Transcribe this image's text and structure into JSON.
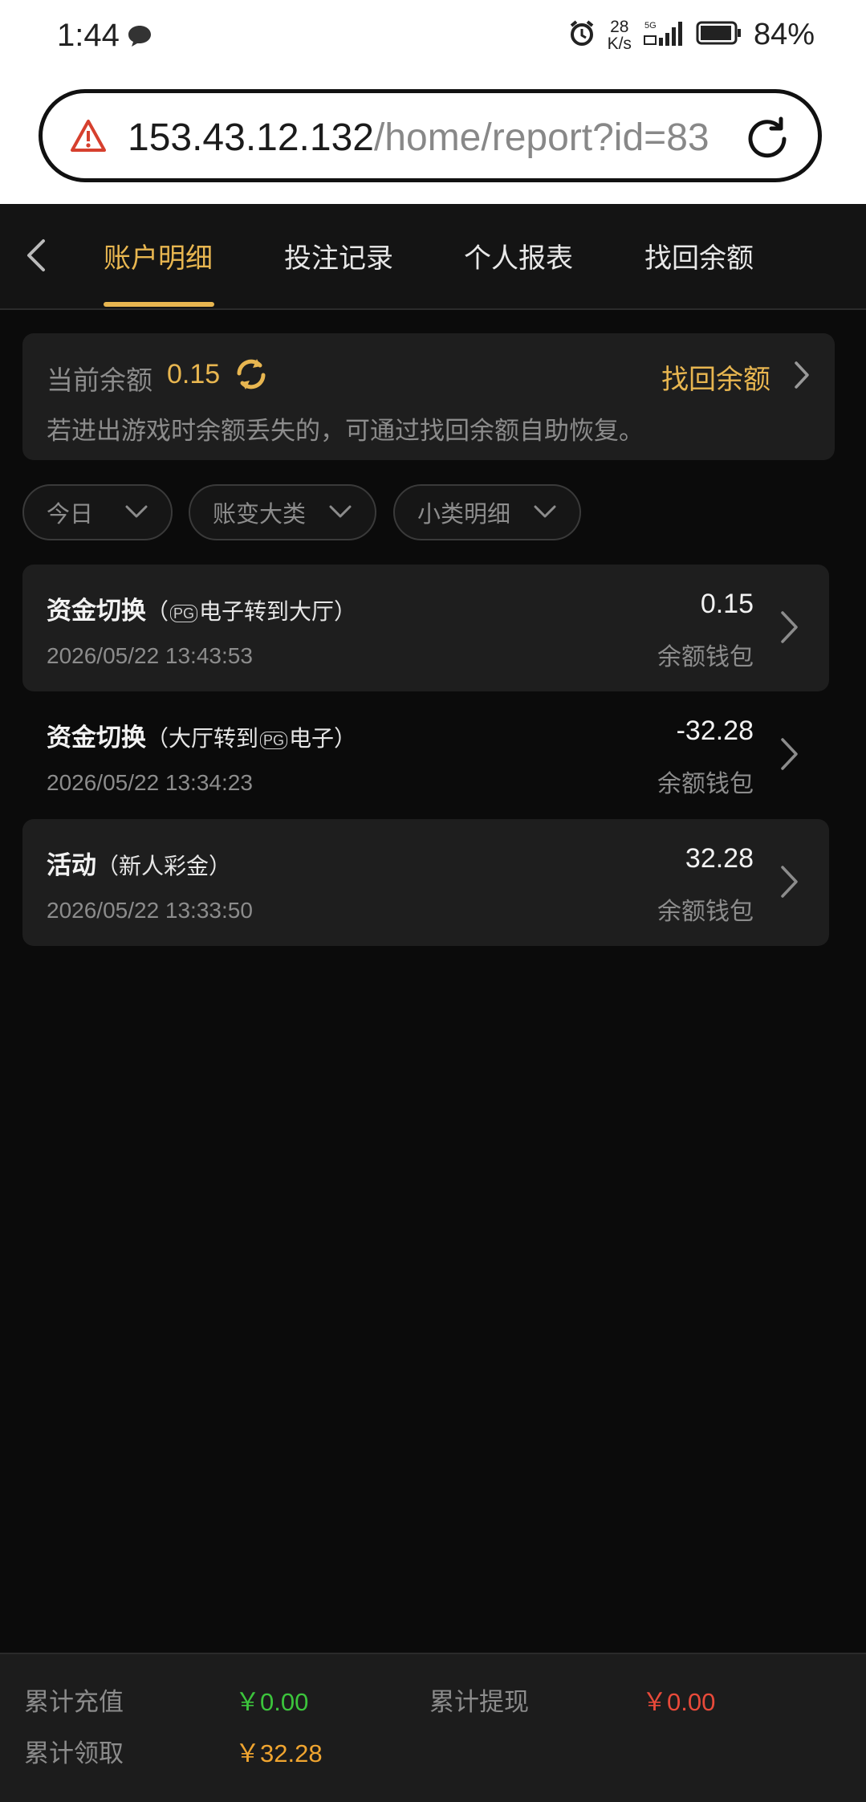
{
  "status_bar": {
    "time": "1:44",
    "speed_value": "28",
    "speed_unit": "K/s",
    "network": "5G",
    "battery_pct": "84%"
  },
  "url": {
    "host": "153.43.12.132",
    "path": "/home/report?id=83"
  },
  "nav": {
    "tabs": [
      "账户明细",
      "投注记录",
      "个人报表",
      "找回余额"
    ],
    "active_tab": 0
  },
  "balance": {
    "label": "当前余额",
    "value": "0.15",
    "recover_label": "找回余额",
    "hint": "若进出游戏时余额丢失的，可通过找回余额自助恢复。"
  },
  "filters": [
    {
      "label": "今日"
    },
    {
      "label": "账变大类"
    },
    {
      "label": "小类明细"
    }
  ],
  "transactions": [
    {
      "title": "资金切换",
      "sub_pre": "（",
      "sub_badge": "PG",
      "sub_post": "电子转到大厅）",
      "time": "2026/05/22 13:43:53",
      "amount": "0.15",
      "wallet": "余额钱包"
    },
    {
      "title": "资金切换",
      "sub_pre": "（大厅转到",
      "sub_badge": "PG",
      "sub_post": "电子）",
      "time": "2026/05/22 13:34:23",
      "amount": "-32.28",
      "wallet": "余额钱包"
    },
    {
      "title": "活动",
      "sub_pre": "（新人彩金）",
      "sub_badge": "",
      "sub_post": "",
      "time": "2026/05/22 13:33:50",
      "amount": "32.28",
      "wallet": "余额钱包"
    }
  ],
  "footer": {
    "deposit_label": "累计充值",
    "deposit_value": "￥0.00",
    "withdraw_label": "累计提现",
    "withdraw_value": "￥0.00",
    "claim_label": "累计领取",
    "claim_value": "￥32.28"
  },
  "colors": {
    "accent": "#e8b650",
    "green": "#3cc43c",
    "red": "#e84a3a",
    "orange": "#f0a530"
  }
}
